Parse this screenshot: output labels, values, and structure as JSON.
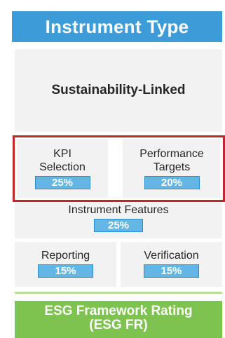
{
  "header": {
    "title": "Instrument Type"
  },
  "instrument": {
    "type": "Sustainability-Linked"
  },
  "components": {
    "kpi": {
      "label": "KPI\nSelection",
      "weight": "25%"
    },
    "targets": {
      "label": "Performance\nTargets",
      "weight": "20%"
    },
    "features": {
      "label": "Instrument Features",
      "weight": "25%"
    },
    "reporting": {
      "label": "Reporting",
      "weight": "15%"
    },
    "verification": {
      "label": "Verification",
      "weight": "15%"
    }
  },
  "footer": {
    "title": "ESG Framework Rating\n(ESG FR)"
  },
  "colors": {
    "header": "#3d9bd8",
    "badge": "#64b7e5",
    "highlight": "#c0272d",
    "footer": "#7ec34f"
  }
}
